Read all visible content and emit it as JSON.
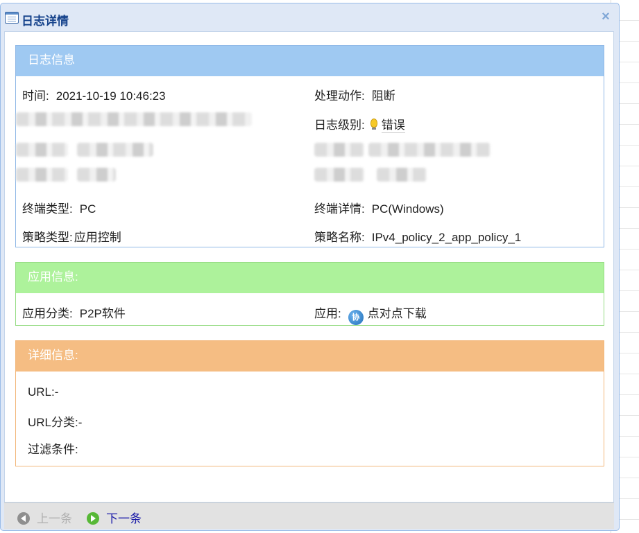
{
  "dialog": {
    "title": "日志详情",
    "close_label": "×"
  },
  "log_info": {
    "header": "日志信息",
    "time_label": "时间:",
    "time_value": "2021-10-19 10:46:23",
    "action_label": "处理动作:",
    "action_value": "阻断",
    "level_label": "日志级别:",
    "level_value": "错误",
    "terminal_type_label": "终端类型:",
    "terminal_type_value": "PC",
    "terminal_detail_label": "终端详情:",
    "terminal_detail_value": "PC(Windows)",
    "policy_type_label": "策略类型:",
    "policy_type_value": "应用控制",
    "policy_name_label": "策略名称:",
    "policy_name_value": "IPv4_policy_2_app_policy_1"
  },
  "app_info": {
    "header": "应用信息:",
    "category_label": "应用分类:",
    "category_value": "P2P软件",
    "app_label": "应用:",
    "app_icon_text": "协",
    "app_value": "点对点下载"
  },
  "detail_info": {
    "header": "详细信息:",
    "url_label": "URL:",
    "url_value": "-",
    "url_category_label": "URL分类:",
    "url_category_value": "-",
    "filter_label": "过滤条件:"
  },
  "footer": {
    "prev_label": "上一条",
    "next_label": "下一条"
  },
  "colors": {
    "log_header": "#9fc9f2",
    "app_header": "#adf29b",
    "detail_header": "#f5bd83",
    "title_text": "#15428b",
    "next_link": "#1a1aa8"
  }
}
